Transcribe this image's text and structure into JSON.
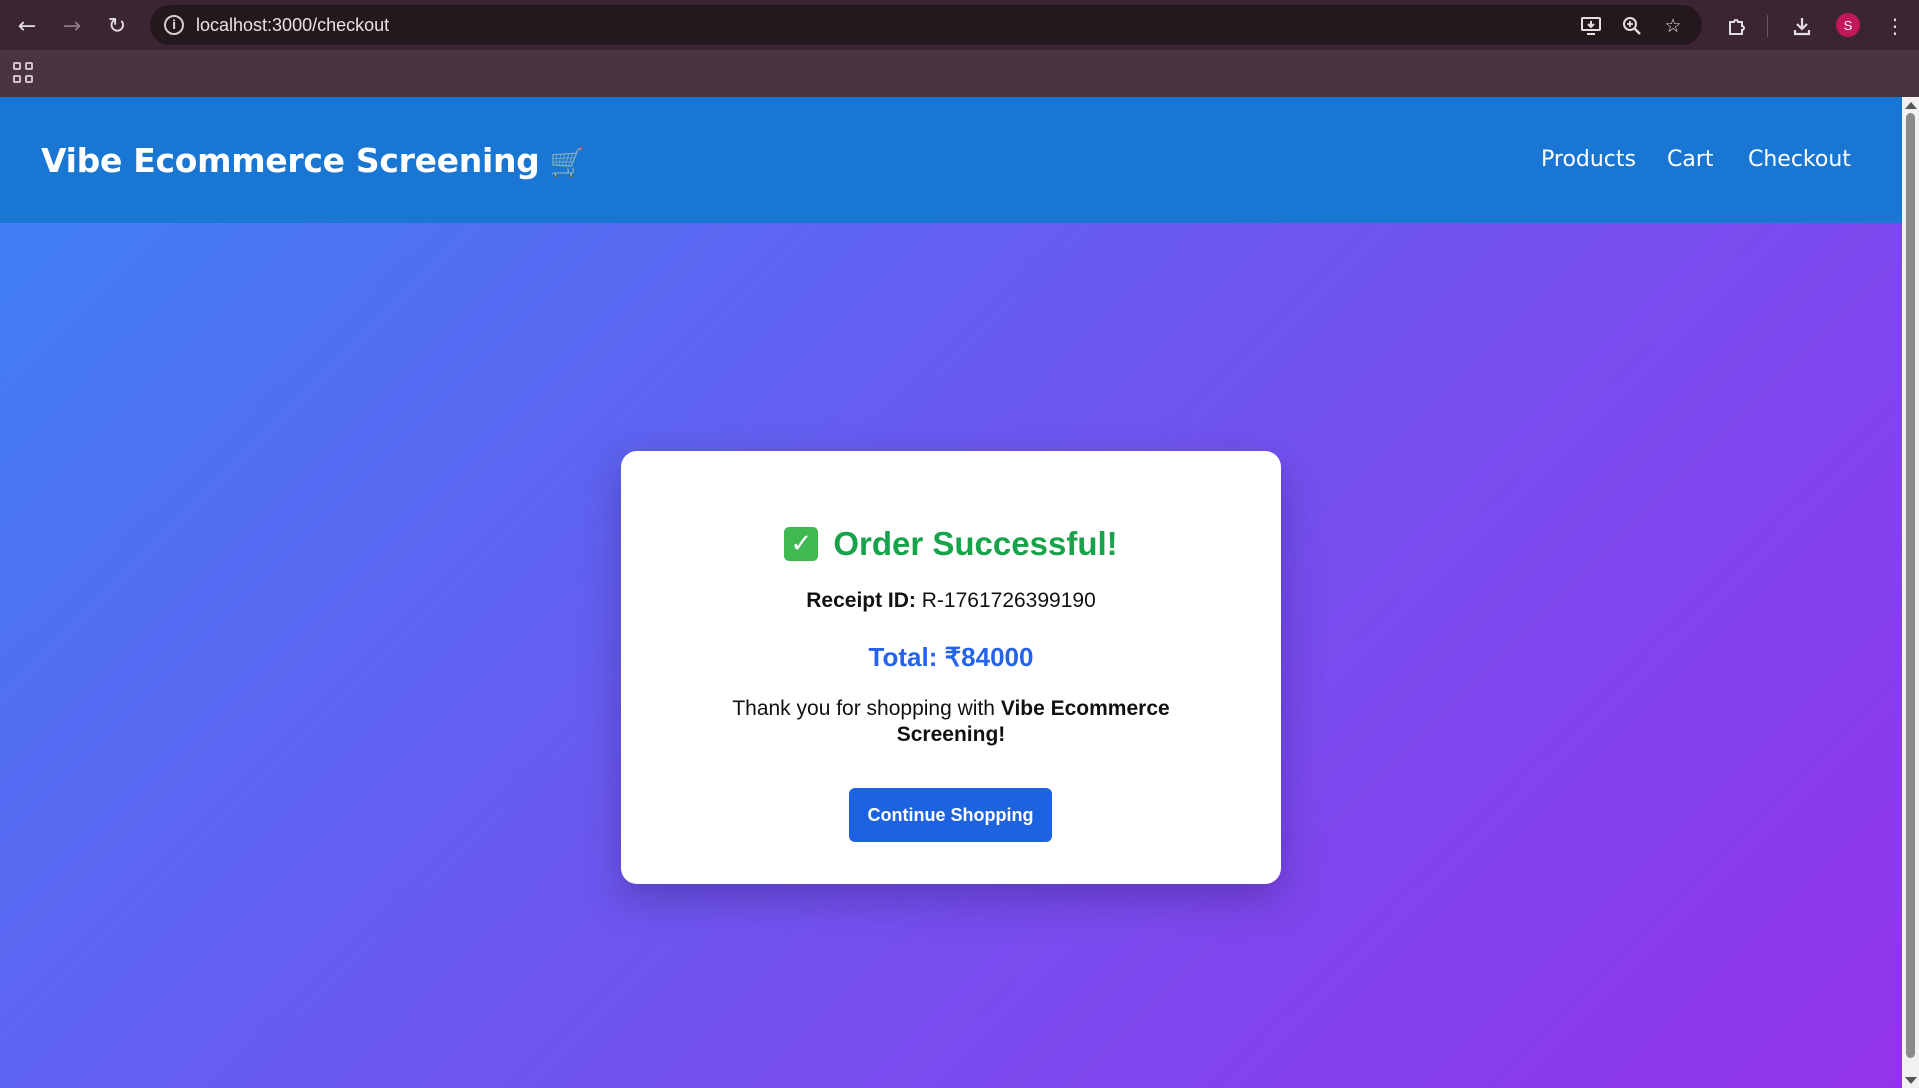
{
  "browser": {
    "url": "localhost:3000/checkout",
    "back_icon": "←",
    "forward_icon": "→",
    "reload_icon": "↻",
    "info_icon": "i",
    "avatar_initial": "S",
    "icons": [
      "install-app-icon",
      "zoom-icon",
      "bookmark-star-icon",
      "extensions-icon",
      "download-icon",
      "menu-icon"
    ]
  },
  "header": {
    "brand": "Vibe Ecommerce Screening",
    "brand_emoji": "🛒",
    "nav": [
      "Products",
      "Cart",
      "Checkout"
    ]
  },
  "order": {
    "title": "Order Successful!",
    "receipt_label": "Receipt ID:",
    "receipt_id": "R-1761726399190",
    "total": "Total: ₹84000",
    "thanks_prefix": "Thank you for shopping with",
    "thanks_brand": "Vibe Ecommerce Screening!",
    "button": "Continue Shopping"
  },
  "colors": {
    "header_bg": "#1976d2",
    "success": "#16a34a",
    "total": "#2563eb",
    "button": "#1d63e0"
  }
}
